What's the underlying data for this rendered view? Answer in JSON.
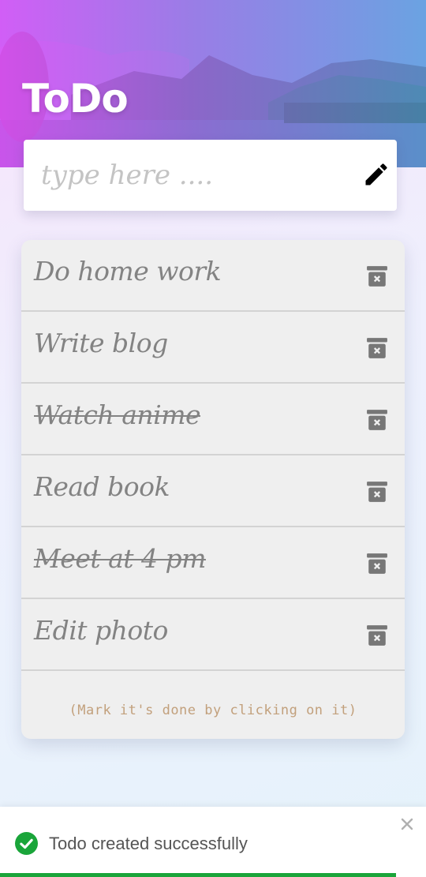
{
  "app": {
    "title": "ToDo"
  },
  "input": {
    "placeholder": "type here ....",
    "value": ""
  },
  "todos": [
    {
      "text": "Do home work",
      "done": false
    },
    {
      "text": "Write blog",
      "done": false
    },
    {
      "text": "Watch anime",
      "done": true
    },
    {
      "text": "Read book",
      "done": false
    },
    {
      "text": "Meet at 4 pm",
      "done": true
    },
    {
      "text": "Edit photo",
      "done": false
    }
  ],
  "hint": "(Mark it's done by clicking on it)",
  "toast": {
    "message": "Todo created successfully",
    "progress": 0.93
  },
  "colors": {
    "accent": "#e84aff",
    "success": "#1aa53a",
    "list_bg": "#efefef",
    "hint": "#c2a07c"
  },
  "icons": {
    "edit": "pencil-icon",
    "delete": "trash-icon",
    "toast": "check-circle-icon",
    "close": "close-icon"
  }
}
